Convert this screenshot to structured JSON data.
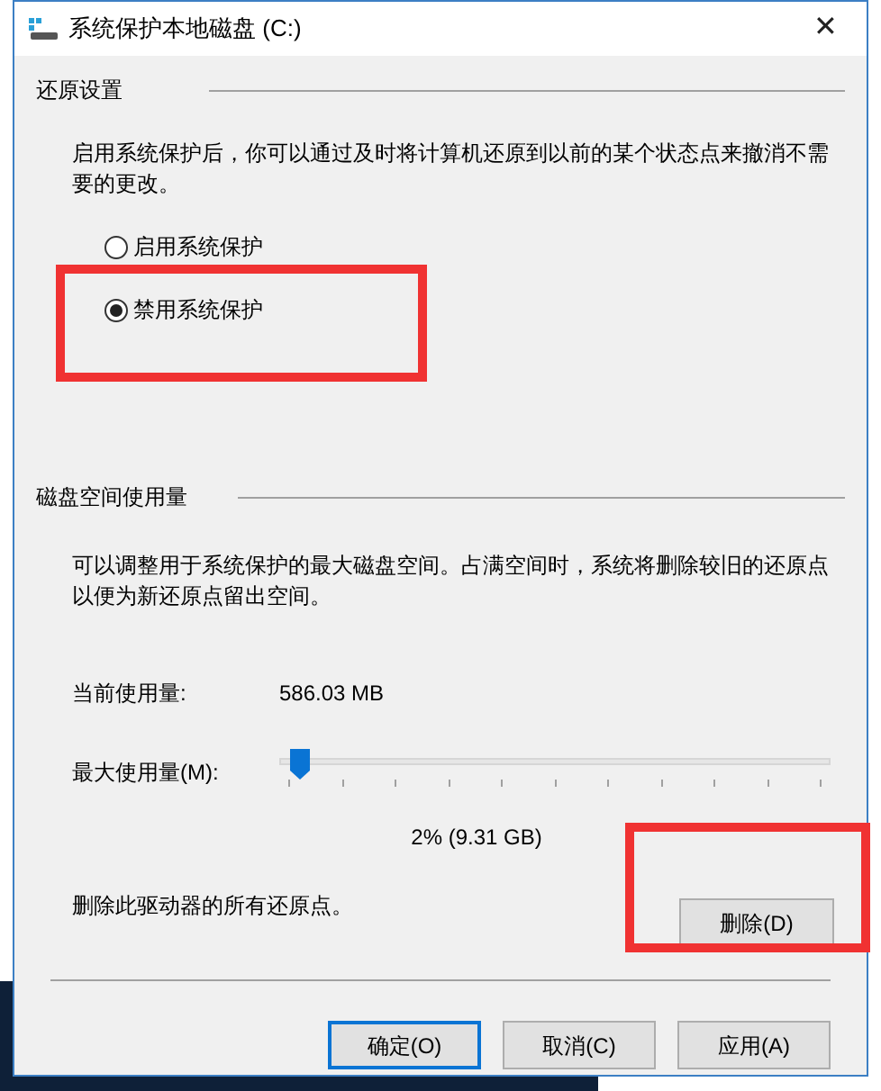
{
  "window": {
    "title": "系统保护本地磁盘 (C:)",
    "close": "✕"
  },
  "restore_settings": {
    "heading": "还原设置",
    "description": "启用系统保护后，你可以通过及时将计算机还原到以前的某个状态点来撤消不需要的更改。",
    "options": [
      {
        "label": "启用系统保护",
        "selected": false
      },
      {
        "label": "禁用系统保护",
        "selected": true
      }
    ]
  },
  "disk_usage": {
    "heading": "磁盘空间使用量",
    "description": "可以调整用于系统保护的最大磁盘空间。占满空间时，系统将删除较旧的还原点以便为新还原点留出空间。",
    "current_label": "当前使用量:",
    "current_value": "586.03 MB",
    "max_label": "最大使用量(M):",
    "max_slider": {
      "level": 0.02
    },
    "max_reading": "2% (9.31 GB)",
    "delete_text": "删除此驱动器的所有还原点。",
    "delete_button": "删除(D)"
  },
  "buttons": [
    {
      "label": "确定(O)",
      "selected": true
    },
    {
      "label": "取消(C)",
      "selected": false
    },
    {
      "label": "应用(A)",
      "selected": false
    }
  ]
}
